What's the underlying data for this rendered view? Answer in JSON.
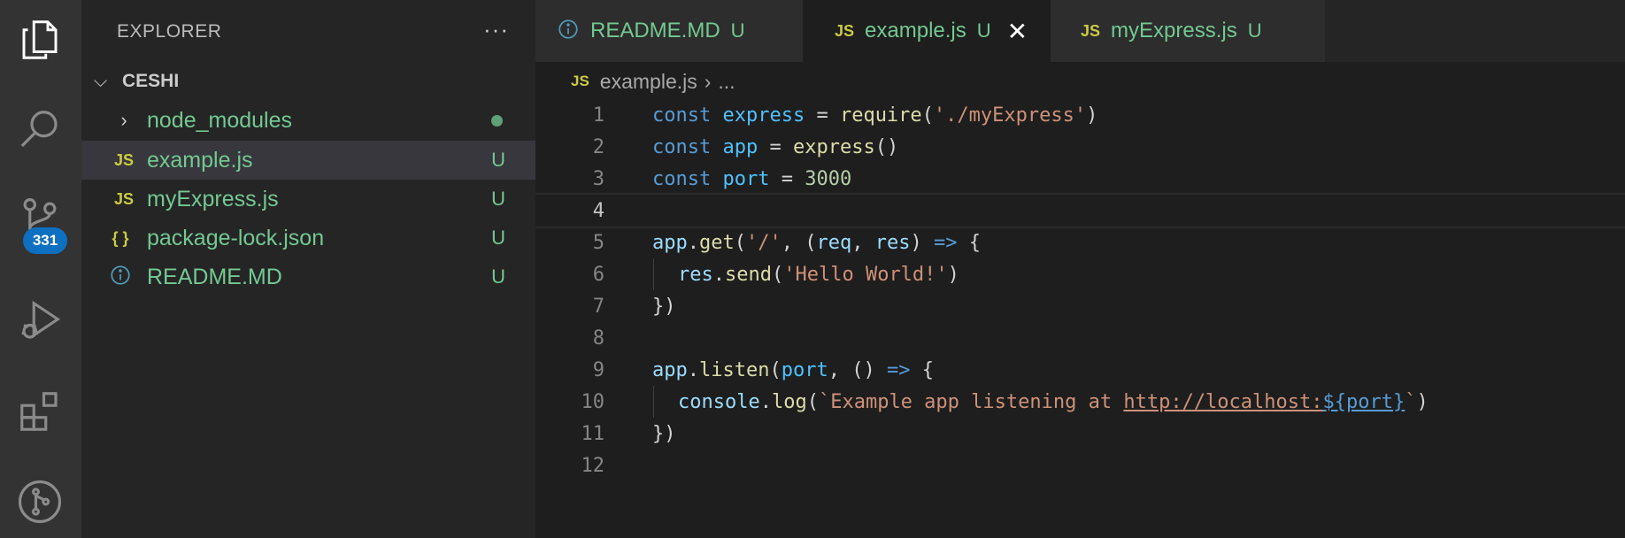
{
  "activity_bar": {
    "items": [
      {
        "icon": "explorer-icon"
      },
      {
        "icon": "search-icon"
      },
      {
        "icon": "source-control-icon",
        "badge": "331"
      },
      {
        "icon": "run-debug-icon"
      },
      {
        "icon": "extensions-icon"
      },
      {
        "icon": "git-graph-icon"
      }
    ]
  },
  "sidebar": {
    "title": "EXPLORER",
    "more": "···",
    "folder": "CESHI",
    "items": [
      {
        "label": "node_modules",
        "icon": "chevron-right-icon",
        "status": ""
      },
      {
        "label": "example.js",
        "icon_text": "JS",
        "status": "U"
      },
      {
        "label": "myExpress.js",
        "icon_text": "JS",
        "status": "U"
      },
      {
        "label": "package-lock.json",
        "icon_text": "{ }",
        "status": "U"
      },
      {
        "label": "README.MD",
        "icon": "info-icon",
        "status": "U"
      }
    ]
  },
  "tabs": [
    {
      "label": "README.MD",
      "status": "U"
    },
    {
      "label": "example.js",
      "icon_text": "JS",
      "status": "U",
      "close": "✕"
    },
    {
      "label": "myExpress.js",
      "icon_text": "JS",
      "status": "U"
    }
  ],
  "breadcrumb": {
    "icon_text": "JS",
    "file": "example.js",
    "sep": "›",
    "rest": "..."
  },
  "editor": {
    "current_line": 4,
    "line_numbers": [
      "1",
      "2",
      "3",
      "4",
      "5",
      "6",
      "7",
      "8",
      "9",
      "10",
      "11",
      "12"
    ],
    "code": {
      "l1": {
        "kw": "const",
        "var": "express",
        "op": " = ",
        "fn": "require",
        "p1": "(",
        "str": "'./myExpress'",
        "p2": ")"
      },
      "l2": {
        "kw": "const",
        "var": "app",
        "op": " = ",
        "fn": "express",
        "p": "()"
      },
      "l3": {
        "kw": "const",
        "var": "port",
        "op": " = ",
        "num": "3000"
      },
      "l5": {
        "obj": "app",
        "dot": ".",
        "fn": "get",
        "p1": "(",
        "str": "'/'",
        "c1": ", (",
        "a1": "req",
        "c2": ", ",
        "a2": "res",
        "c3": ") ",
        "arrow": "=>",
        "c4": " {"
      },
      "l6": {
        "obj": "res",
        "dot": ".",
        "fn": "send",
        "p1": "(",
        "str": "'Hello World!'",
        "p2": ")"
      },
      "l7": "})",
      "l9": {
        "obj": "app",
        "dot": ".",
        "fn": "listen",
        "p1": "(",
        "var": "port",
        "c1": ", () ",
        "arrow": "=>",
        "c2": " {"
      },
      "l10": {
        "obj": "console",
        "dot": ".",
        "fn": "log",
        "p1": "(",
        "str1": "`Example app listening at ",
        "url": "http://localhost:",
        "tmpl": "${port}",
        "str2": "`",
        "p2": ")"
      },
      "l11": "})"
    }
  },
  "colors": {
    "activity_bg": "#333333",
    "sidebar_bg": "#252526",
    "editor_bg": "#1e1e1e",
    "untracked_green": "#73c991",
    "badge_blue": "#0e70c0",
    "js_yellow": "#cbcb41"
  }
}
